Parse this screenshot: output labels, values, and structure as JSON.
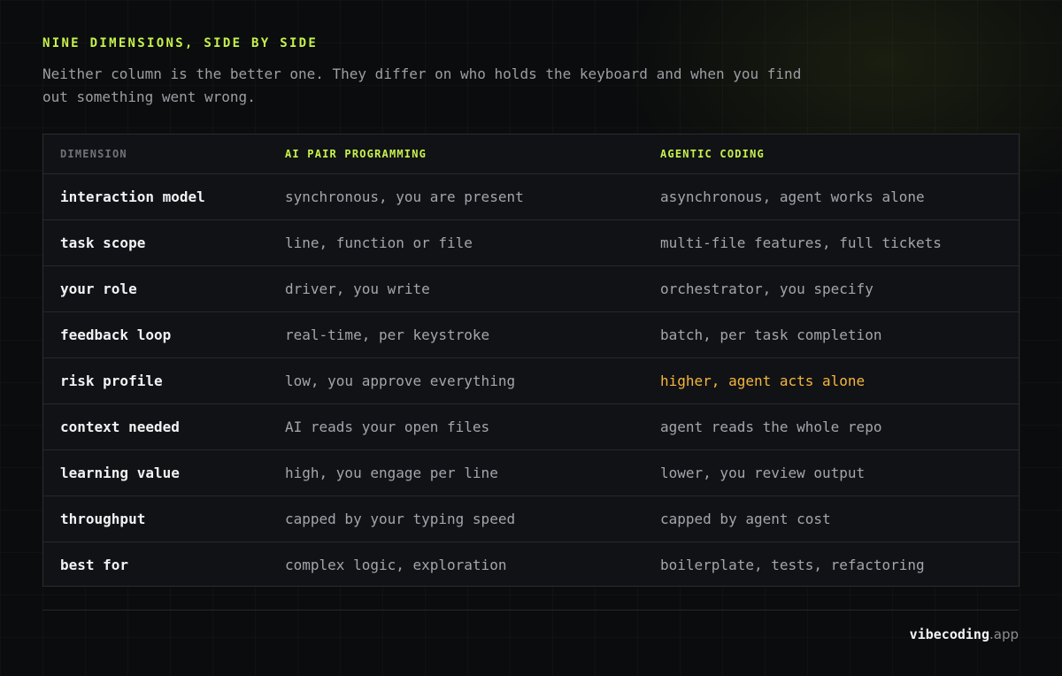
{
  "header": {
    "eyebrow": "NINE DIMENSIONS, SIDE BY SIDE",
    "subtitle": "Neither column is the better one. They differ on who holds the keyboard and when you find out something went wrong."
  },
  "table": {
    "columns": [
      "DIMENSION",
      "AI PAIR PROGRAMMING",
      "AGENTIC CODING"
    ],
    "rows": [
      [
        "interaction model",
        "synchronous, you are present",
        "asynchronous, agent works alone"
      ],
      [
        "task scope",
        "line, function or file",
        "multi-file features, full tickets"
      ],
      [
        "your role",
        "driver, you write",
        "orchestrator, you specify"
      ],
      [
        "feedback loop",
        "real-time, per keystroke",
        "batch, per task completion"
      ],
      [
        "risk profile",
        "low, you approve everything",
        "higher, agent acts alone"
      ],
      [
        "context needed",
        "AI reads your open files",
        "agent reads the whole repo"
      ],
      [
        "learning value",
        "high, you engage per line",
        "lower, you review output"
      ],
      [
        "throughput",
        "capped by your typing speed",
        "capped by agent cost"
      ],
      [
        "best for",
        "complex logic, exploration",
        "boilerplate, tests, refactoring"
      ]
    ],
    "highlighted_cell": {
      "row": 4,
      "column": 2
    }
  },
  "footer": {
    "brand_name": "vibecoding",
    "brand_tld": ".app"
  },
  "colors": {
    "accent": "#c6f24e",
    "warning": "#f4b63e",
    "background": "#0b0c0d",
    "table_background": "#111215"
  }
}
